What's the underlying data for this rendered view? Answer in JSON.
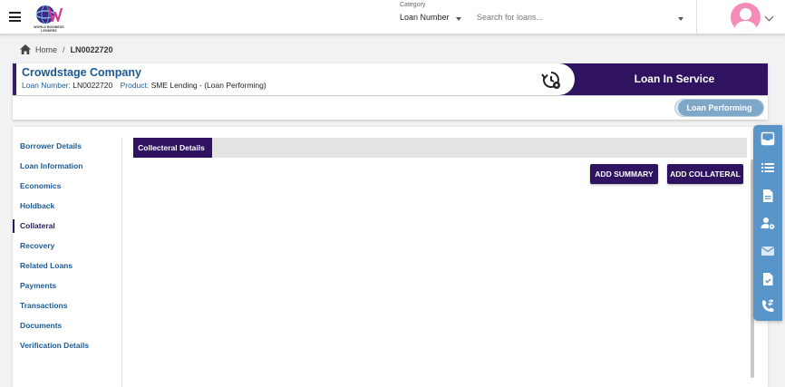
{
  "topbar": {
    "logo_text": "WORLD BUSINESS LENDERS",
    "category_label": "Category",
    "category_value": "Loan Number",
    "search_placeholder": "Search for loans..."
  },
  "breadcrumb": {
    "home": "Home",
    "separator": "/",
    "current": "LN0022720"
  },
  "header": {
    "company": "Crowdstage Company",
    "loan_number_label": "Loan Number:",
    "loan_number": "LN0022720",
    "product_label": "Product:",
    "product": "SME Lending - (Loan Performing)",
    "status_title": "Loan In Service",
    "status_pill": "Loan Performing"
  },
  "left_nav": {
    "items": [
      {
        "label": "Borrower Details"
      },
      {
        "label": "Loan Information"
      },
      {
        "label": "Economics"
      },
      {
        "label": "Holdback"
      },
      {
        "label": "Collateral"
      },
      {
        "label": "Recovery"
      },
      {
        "label": "Related Loans"
      },
      {
        "label": "Payments"
      },
      {
        "label": "Transactions"
      },
      {
        "label": "Documents"
      },
      {
        "label": "Verification Details"
      }
    ],
    "active_index": 4
  },
  "content": {
    "tab_label": "Collecteral Details",
    "add_summary": "ADD SUMMARY",
    "add_collateral": "ADD COLLATERAL"
  },
  "right_toolbar": {
    "icons": [
      "inbox-icon",
      "list-icon",
      "document-icon",
      "user-settings-icon",
      "mail-icon",
      "document-check-icon",
      "phone-transfer-icon"
    ]
  },
  "colors": {
    "primary_purple": "#2f1361",
    "link_blue": "#1a5a96",
    "toolbar_blue": "#5a95c9",
    "pill_blue": "#7fa7c8",
    "avatar_pink": "#f58bb7"
  }
}
